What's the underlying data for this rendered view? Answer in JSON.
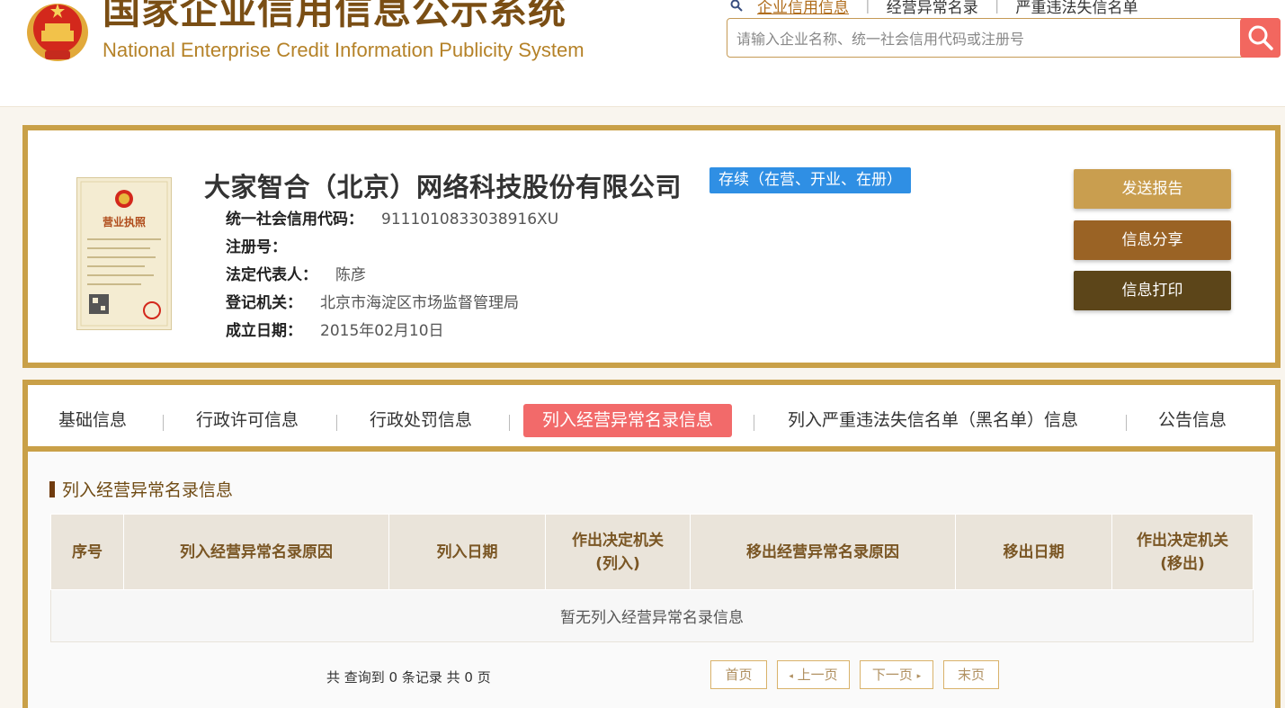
{
  "header": {
    "title_cn": "国家企业信用信息公示系统",
    "title_en": "National Enterprise Credit Information Publicity System",
    "nav": [
      {
        "label": "企业信用信息",
        "active": true
      },
      {
        "label": "经营异常名录",
        "active": false
      },
      {
        "label": "严重违法失信名单",
        "active": false
      }
    ],
    "search_placeholder": "请输入企业名称、统一社会信用代码或注册号"
  },
  "company": {
    "name": "大家智合（北京）网络科技股份有限公司",
    "status": "存续（在营、开业、在册）",
    "fields": [
      {
        "label": "统一社会信用代码：",
        "value": "9111010833038916XU"
      },
      {
        "label": "注册号：",
        "value": ""
      },
      {
        "label": "法定代表人：",
        "value": "陈彦"
      },
      {
        "label": "登记机关：",
        "value": "北京市海淀区市场监督管理局"
      },
      {
        "label": "成立日期：",
        "value": "2015年02月10日"
      }
    ],
    "license_title": "营业执照"
  },
  "actions": {
    "send": "发送报告",
    "share": "信息分享",
    "print": "信息打印"
  },
  "tabs": [
    {
      "label": "基础信息"
    },
    {
      "label": "行政许可信息"
    },
    {
      "label": "行政处罚信息"
    },
    {
      "label": "列入经营异常名录信息",
      "active": true
    },
    {
      "label": "列入严重违法失信名单（黑名单）信息"
    },
    {
      "label": "公告信息"
    }
  ],
  "section": {
    "title": "列入经营异常名录信息",
    "columns": [
      "序号",
      "列入经营异常名录原因",
      "列入日期",
      "作出决定机关\n(列入)",
      "移出经营异常名录原因",
      "移出日期",
      "作出决定机关\n(移出)"
    ],
    "empty_text": "暂无列入经营异常名录信息"
  },
  "pagination": {
    "summary": "共 查询到 0 条记录 共 0 页",
    "first": "首页",
    "prev": "上一页",
    "next": "下一页",
    "last": "末页"
  },
  "colors": {
    "brand_gold": "#c9a048",
    "active_tab": "#f26a6a",
    "status_blue": "#2f8fe4",
    "search_btn": "#f2675f"
  }
}
